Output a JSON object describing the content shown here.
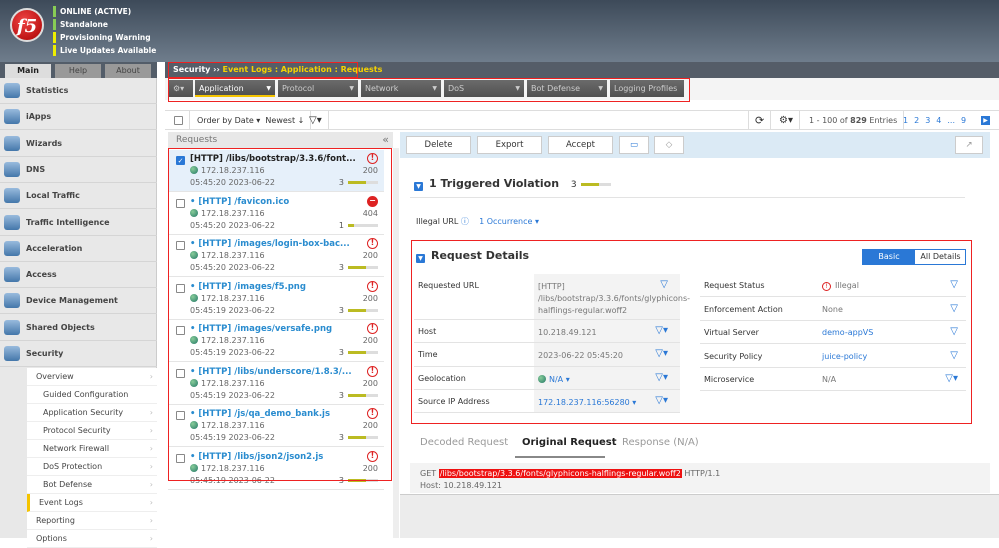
{
  "header": {
    "logo": "f5",
    "status": [
      {
        "text": "ONLINE (ACTIVE)",
        "color": "#88cc55"
      },
      {
        "text": "Standalone",
        "color": "#88cc55"
      },
      {
        "text": "Provisioning Warning",
        "color": "#eeee00"
      },
      {
        "text": "Live Updates Available",
        "color": "#eeee00"
      }
    ]
  },
  "tabs": [
    "Main",
    "Help",
    "About"
  ],
  "sidebar": {
    "items": [
      "Statistics",
      "iApps",
      "Wizards",
      "DNS",
      "Local Traffic",
      "Traffic Intelligence",
      "Acceleration",
      "Access",
      "Device Management",
      "Shared Objects",
      "Security"
    ],
    "security_sub": [
      "Overview",
      "Guided Configuration",
      "Application Security",
      "Protocol Security",
      "Network Firewall",
      "DoS Protection",
      "Bot Defense",
      "Event Logs",
      "Reporting",
      "Options"
    ]
  },
  "breadcrumb": {
    "root": "Security",
    "sep": "››",
    "path": "Event Logs : Application : Requests"
  },
  "menu": [
    "Application",
    "Protocol",
    "Network",
    "DoS",
    "Bot Defense",
    "Logging Profiles"
  ],
  "toolbar": {
    "order": "Order by Date ▾",
    "newest": "Newest ↓",
    "filter": "▽▾",
    "refresh": "⟳",
    "settings": "⚙▾",
    "entries_pre": "1 - 100 of ",
    "entries_count": "829",
    "entries_post": " Entries",
    "pages": [
      "1",
      "2",
      "3",
      "4",
      "...",
      "9"
    ]
  },
  "requests": {
    "title": "Requests",
    "collapse": "«",
    "items": [
      {
        "url": "[HTTP] /libs/bootstrap/3.3.6/font...",
        "ip": "172.18.237.116",
        "time": "05:45:20 2023-06-22",
        "code": "200",
        "rating": "3",
        "sev": "!",
        "blocked": false,
        "selected": true,
        "fill": 0.6
      },
      {
        "url": "• [HTTP] /favicon.ico",
        "ip": "172.18.237.116",
        "time": "05:45:20 2023-06-22",
        "code": "404",
        "rating": "1",
        "sev": "−",
        "blocked": true,
        "selected": false,
        "fill": 0.2
      },
      {
        "url": "• [HTTP] /images/login-box-bac...",
        "ip": "172.18.237.116",
        "time": "05:45:20 2023-06-22",
        "code": "200",
        "rating": "3",
        "sev": "!",
        "blocked": false,
        "selected": false,
        "fill": 0.6
      },
      {
        "url": "• [HTTP] /images/f5.png",
        "ip": "172.18.237.116",
        "time": "05:45:19 2023-06-22",
        "code": "200",
        "rating": "3",
        "sev": "!",
        "blocked": false,
        "selected": false,
        "fill": 0.6
      },
      {
        "url": "• [HTTP] /images/versafe.png",
        "ip": "172.18.237.116",
        "time": "05:45:19 2023-06-22",
        "code": "200",
        "rating": "3",
        "sev": "!",
        "blocked": false,
        "selected": false,
        "fill": 0.6
      },
      {
        "url": "• [HTTP] /libs/underscore/1.8.3/...",
        "ip": "172.18.237.116",
        "time": "05:45:19 2023-06-22",
        "code": "200",
        "rating": "3",
        "sev": "!",
        "blocked": false,
        "selected": false,
        "fill": 0.6
      },
      {
        "url": "• [HTTP] /js/qa_demo_bank.js",
        "ip": "172.18.237.116",
        "time": "05:45:19 2023-06-22",
        "code": "200",
        "rating": "3",
        "sev": "!",
        "blocked": false,
        "selected": false,
        "fill": 0.6
      },
      {
        "url": "• [HTTP] /libs/json2/json2.js",
        "ip": "172.18.237.116",
        "time": "05:45:19 2023-06-22",
        "code": "200",
        "rating": "3",
        "sev": "!",
        "blocked": false,
        "selected": false,
        "fill": 0.6
      }
    ]
  },
  "detail": {
    "buttons": [
      "Delete",
      "Export",
      "Accept"
    ],
    "violation_title": "1 Triggered Violation",
    "violation_rating": "3",
    "illegal_url": "Illegal URL",
    "occurrence": "1 Occurrence ▾",
    "rd_title": "Request Details",
    "basic": "Basic",
    "all": "All Details",
    "left": [
      {
        "k": "Requested URL",
        "v": "[HTTP] /libs/bootstrap/3.3.6/fonts/glyphicons-halflings-regular.woff2"
      },
      {
        "k": "Host",
        "v": "10.218.49.121"
      },
      {
        "k": "Time",
        "v": "2023-06-22 05:45:20"
      },
      {
        "k": "Geolocation",
        "v": "N/A ▾"
      },
      {
        "k": "Source IP Address",
        "v": "172.18.237.116:56280 ▾"
      }
    ],
    "right": [
      {
        "k": "Request Status",
        "v": "Illegal"
      },
      {
        "k": "Enforcement Action",
        "v": "None"
      },
      {
        "k": "Virtual Server",
        "v": "demo-appVS"
      },
      {
        "k": "Security Policy",
        "v": "juice-policy"
      },
      {
        "k": "Microservice",
        "v": "N/A"
      }
    ],
    "tabs": [
      "Decoded Request",
      "Original Request",
      "Response (N/A)"
    ],
    "raw": {
      "method": "GET",
      "path": "/libs/bootstrap/3.3.6/fonts/glyphicons-halflings-regular.woff2",
      "proto": "HTTP/1.1",
      "host": "Host: 10.218.49.121"
    }
  }
}
